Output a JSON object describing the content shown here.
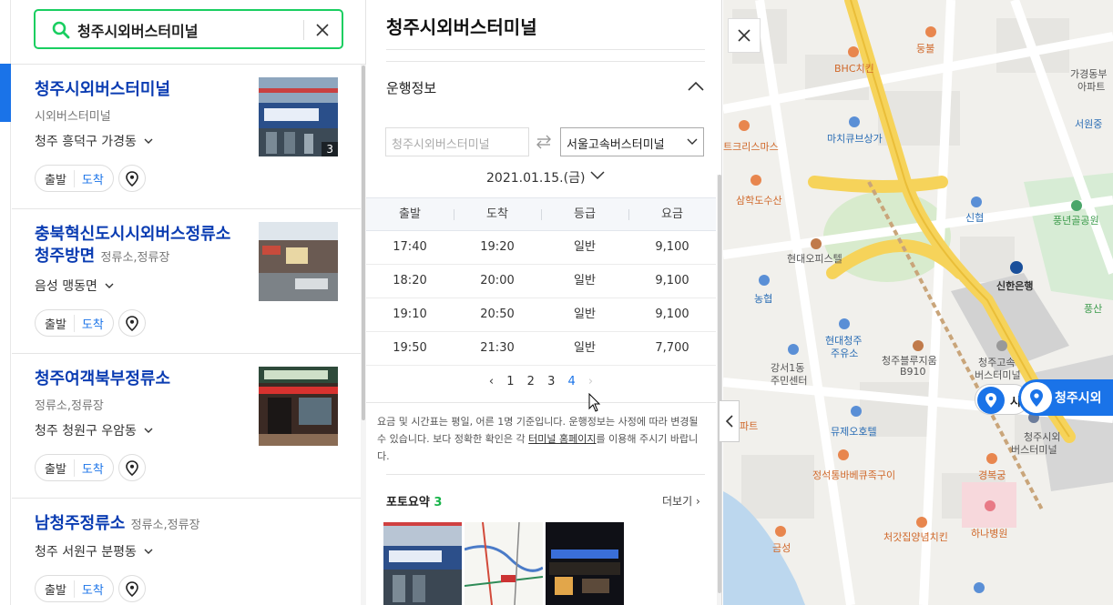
{
  "search": {
    "query": "청주시외버스터미널"
  },
  "results": [
    {
      "title": "청주시외버스터미널",
      "category": "",
      "subcategory": "시외버스터미널",
      "address": "청주 흥덕구 가경동",
      "photo_count": "3",
      "depart": "출발",
      "arrive": "도착"
    },
    {
      "title_line1": "충북혁신도시시외버스정류소",
      "title_line2": "청주방면",
      "category": "정류소,정류장",
      "address": "음성 맹동면",
      "depart": "출발",
      "arrive": "도착"
    },
    {
      "title": "청주여객북부정류소",
      "subcategory": "정류소,정류장",
      "address": "청주 청원구 우암동",
      "depart": "출발",
      "arrive": "도착"
    },
    {
      "title": "남청주정류소",
      "category": "정류소,정류장",
      "address": "청주 서원구 분평동",
      "depart": "출발",
      "arrive": "도착"
    }
  ],
  "detail": {
    "name": "청주시외버스터미널",
    "section_title": "운행정보",
    "from_placeholder": "청주시외버스터미널",
    "to_value": "서울고속버스터미널",
    "date": "2021.01.15.(금)",
    "table": {
      "headers": [
        "출발",
        "도착",
        "등급",
        "요금"
      ],
      "rows": [
        [
          "17:40",
          "19:20",
          "일반",
          "9,100"
        ],
        [
          "18:20",
          "20:00",
          "일반",
          "9,100"
        ],
        [
          "19:10",
          "20:50",
          "일반",
          "9,100"
        ],
        [
          "19:50",
          "21:30",
          "일반",
          "7,700"
        ]
      ]
    },
    "pages": [
      "1",
      "2",
      "3",
      "4"
    ],
    "current_page": "4",
    "notice_before": "요금 및 시간표는 평일, 어른 1명 기준입니다. 운행정보는 사정에 따라 변경될 수 있습니다. 보다 정확한 확인은 각 ",
    "notice_link": "터미널 홈페이지",
    "notice_after": "를 이용해 주시기 바랍니다.",
    "photo_title": "포토요약",
    "photo_count": "3",
    "more": "더보기"
  },
  "map": {
    "labels": {
      "dungbul": "둥불",
      "bhc": "BHC치킨",
      "gagyeong_apt_1": "가경동부",
      "gagyeong_apt_2": "아파트",
      "seowon": "서원중",
      "machu": "마치큐브상가",
      "tricks": "트크리스마스",
      "samhak": "삼학도수산",
      "sinhyup": "신협",
      "pungnyeon": "풍년골공원",
      "hyundai_op": "현대오피스텔",
      "shinhan": "신한은행",
      "nonghyup": "농협",
      "pungsan": "풍산",
      "hyundai_oil_1": "현대청주",
      "hyundai_oil_2": "주유소",
      "blues_1": "청주블루지움",
      "blues_2": "B910",
      "gangseo_1": "강서1동",
      "gangseo_2": "주민센터",
      "express_1": "청주고속",
      "express_2": "버스터미널",
      "intercity_1": "청주시외",
      "intercity_2": "버스터미널",
      "part": "파트",
      "mujeo": "뮤제오호텔",
      "jeongseok": "정석통바베큐족구이",
      "gyeongbok": "경복궁",
      "cheogat": "처갓집양념치킨",
      "hana": "하나병원",
      "geumseong": "금성",
      "pin_main": "청주시외",
      "pin_side": "시"
    }
  }
}
